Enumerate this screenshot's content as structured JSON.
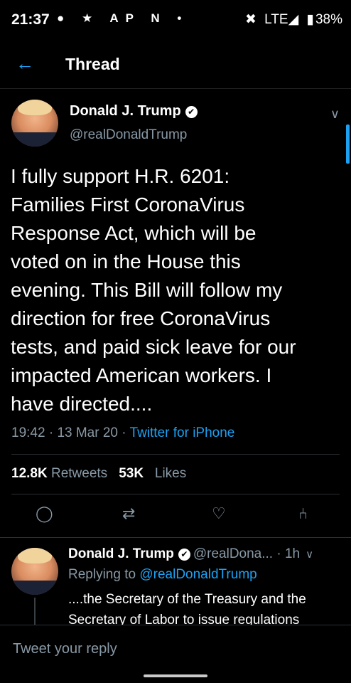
{
  "status_bar": {
    "time": "21:37",
    "left_icons": "● ★ AP N •",
    "mute_icon": "✖",
    "network": "LTE◢",
    "battery_icon": "▮",
    "battery": "38%"
  },
  "header": {
    "back_icon": "←",
    "title": "Thread"
  },
  "main_tweet": {
    "name": "Donald J. Trump",
    "verified_icon": "✔",
    "handle": "@realDonaldTrump",
    "chevron": "∨",
    "text": "I fully support H.R. 6201:\nFamilies First CoronaVirus\nResponse Act, which will be\nvoted on in the House this\nevening. This Bill will follow my\ndirection for free CoronaVirus\ntests, and paid sick leave for our\nimpacted American workers. I\nhave directed....",
    "time": "19:42",
    "sep": " · ",
    "date": "13 Mar 20",
    "source": "Twitter for iPhone",
    "retweets_count": "12.8K",
    "retweets_label": "Retweets",
    "likes_count": "53K",
    "likes_label": "Likes"
  },
  "actions": {
    "reply_icon": "◯",
    "retweet_icon": "⇄",
    "like_icon": "♡",
    "share_icon": "⑃"
  },
  "reply_tweet": {
    "name": "Donald J. Trump",
    "verified_icon": "✔",
    "handle_time": "@realDona... · 1h",
    "chevron": "∨",
    "replying_prefix": "Replying to",
    "replying_to": "@realDonaldTrump",
    "text": "....the Secretary of the Treasury and the Secretary of Labor to issue regulations"
  },
  "compose": {
    "placeholder": "Tweet your reply"
  },
  "colors": {
    "accent": "#1da1f2",
    "muted": "#8899a6",
    "background": "#000000"
  }
}
